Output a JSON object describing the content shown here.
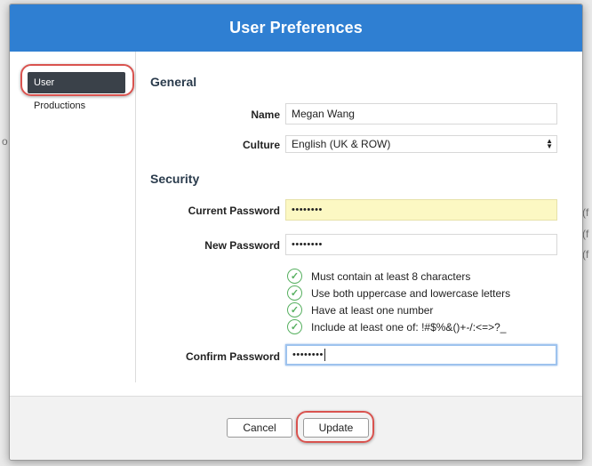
{
  "dialog": {
    "title": "User Preferences"
  },
  "sidebar": {
    "items": [
      {
        "label": "User",
        "active": true
      },
      {
        "label": "Productions",
        "active": false
      }
    ]
  },
  "general": {
    "heading": "General",
    "name_label": "Name",
    "name_value": "Megan Wang",
    "culture_label": "Culture",
    "culture_value": "English (UK & ROW)"
  },
  "security": {
    "heading": "Security",
    "current_password_label": "Current Password",
    "current_password_value": "••••••••",
    "new_password_label": "New Password",
    "new_password_value": "••••••••",
    "rules": [
      "Must contain at least 8 characters",
      "Use both uppercase and lowercase letters",
      "Have at least one number",
      "Include at least one of: !#$%&()+-/:<=>?_"
    ],
    "confirm_password_label": "Confirm Password",
    "confirm_password_value": "••••••••"
  },
  "footer": {
    "cancel_label": "Cancel",
    "update_label": "Update"
  },
  "colors": {
    "header": "#2f7fd2",
    "active_nav": "#3a4149",
    "highlight": "#d9534f",
    "check": "#57b060",
    "autofill": "#fcf8c3"
  }
}
